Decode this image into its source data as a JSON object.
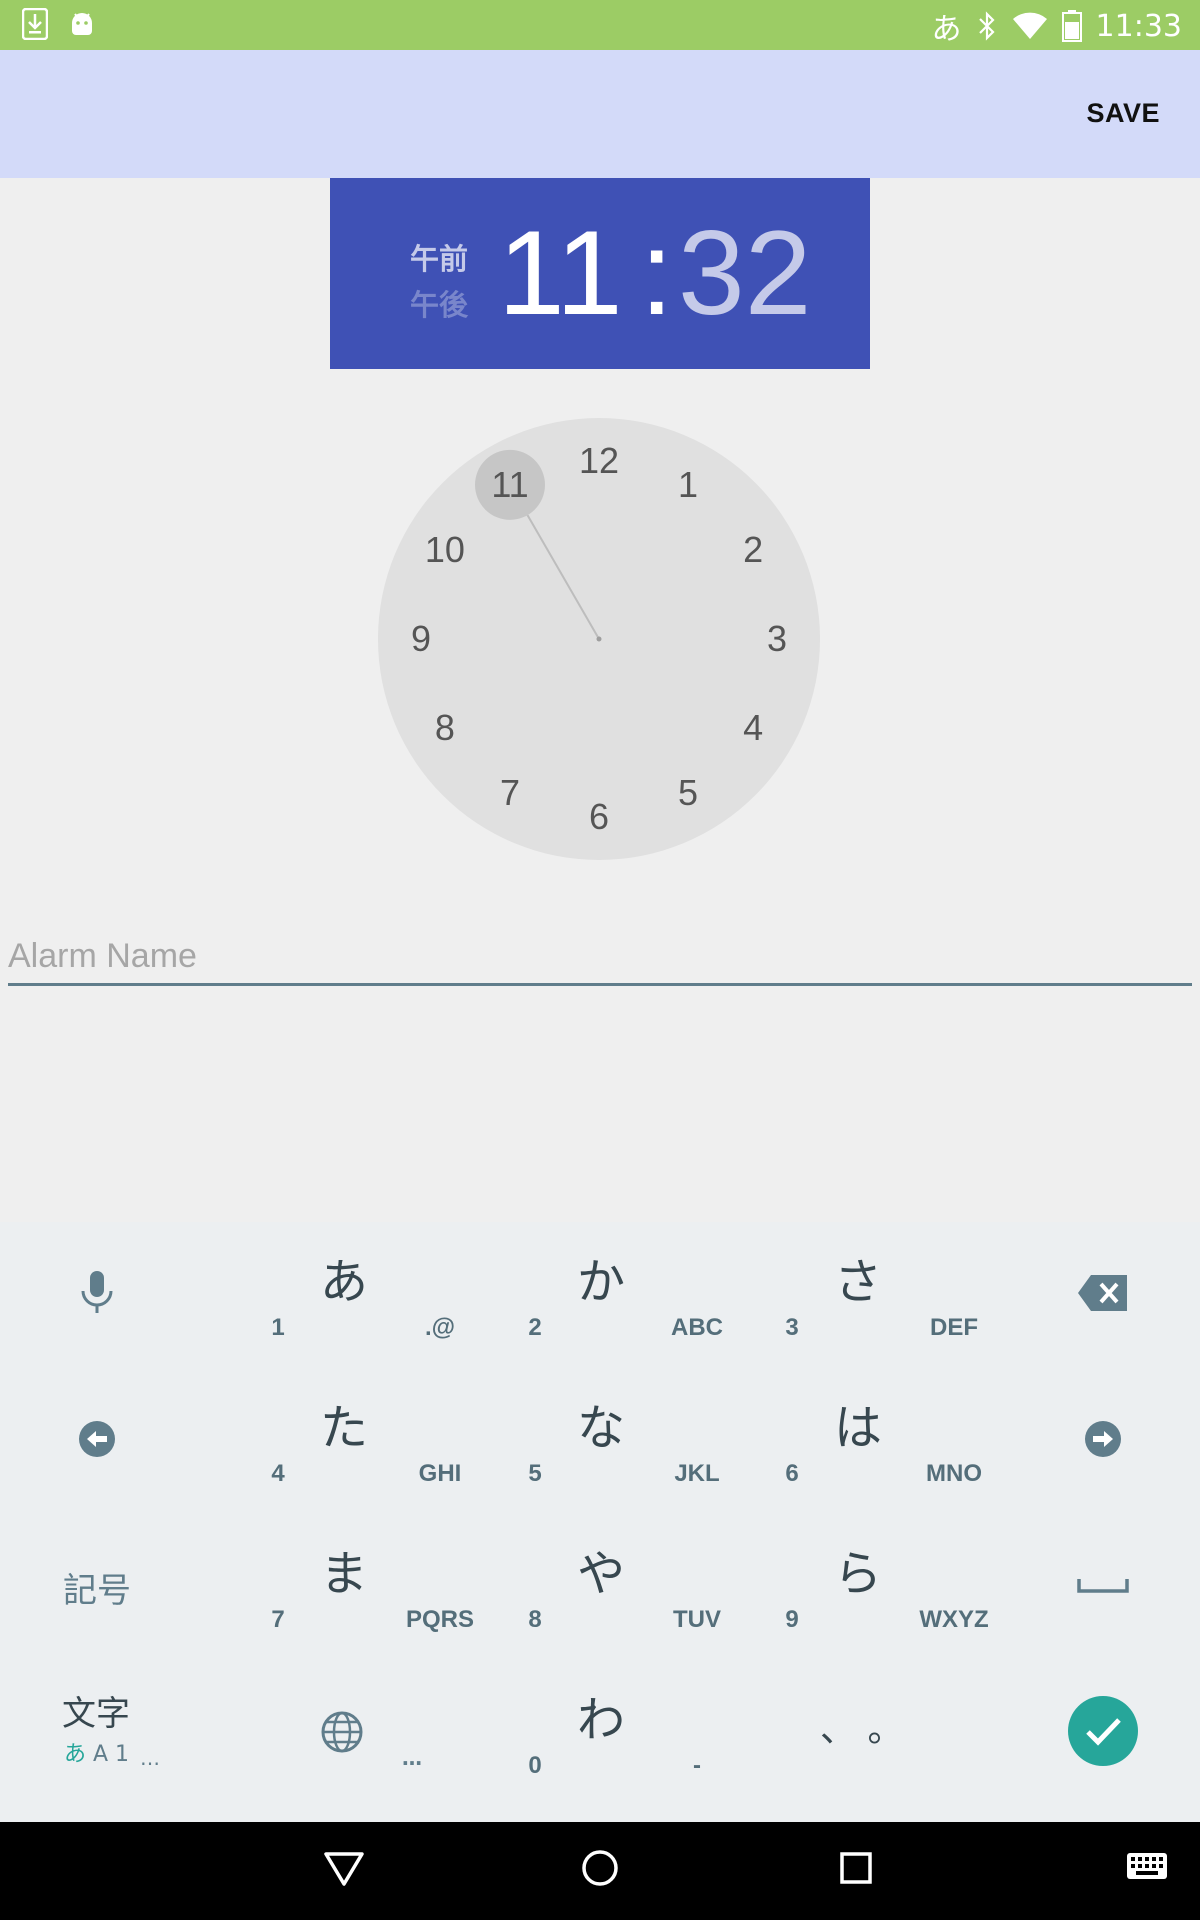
{
  "status_bar": {
    "ime_indicator": "あ",
    "time": "11:33",
    "left_icons": [
      "download-icon",
      "android-debug-icon"
    ],
    "right_icons": [
      "bluetooth-icon",
      "wifi-icon",
      "battery-icon"
    ]
  },
  "app_bar": {
    "save_label": "SAVE"
  },
  "time_header": {
    "am_label": "午前",
    "pm_label": "午後",
    "hour": "11",
    "separator": ":",
    "minute": "32",
    "selected_period": "am",
    "background": "#3f51b5"
  },
  "clock": {
    "numbers": [
      "12",
      "1",
      "2",
      "3",
      "4",
      "5",
      "6",
      "7",
      "8",
      "9",
      "10",
      "11"
    ],
    "selected": "11"
  },
  "alarm_name": {
    "placeholder": "Alarm Name",
    "value": ""
  },
  "keyboard": {
    "rows": [
      {
        "kana": "あ",
        "num": "1",
        "letters": ".@"
      },
      {
        "kana": "か",
        "num": "2",
        "letters": "ABC"
      },
      {
        "kana": "さ",
        "num": "3",
        "letters": "DEF"
      },
      {
        "kana": "た",
        "num": "4",
        "letters": "GHI"
      },
      {
        "kana": "な",
        "num": "5",
        "letters": "JKL"
      },
      {
        "kana": "は",
        "num": "6",
        "letters": "MNO"
      },
      {
        "kana": "ま",
        "num": "7",
        "letters": "PQRS"
      },
      {
        "kana": "や",
        "num": "8",
        "letters": "TUV"
      },
      {
        "kana": "ら",
        "num": "9",
        "letters": "WXYZ"
      },
      {
        "kana": "わ",
        "num": "0",
        "letters": "-"
      }
    ],
    "symbol_key": "記号",
    "mode_key_top": "文字",
    "mode_key_hira": "あ",
    "mode_key_rest": "A 1",
    "ellipsis": "…",
    "punctuation": "、 。",
    "accent_color": "#26a69a"
  },
  "nav_bar": {
    "buttons": [
      "back-icon",
      "home-icon",
      "recents-icon",
      "keyboard-icon"
    ]
  }
}
